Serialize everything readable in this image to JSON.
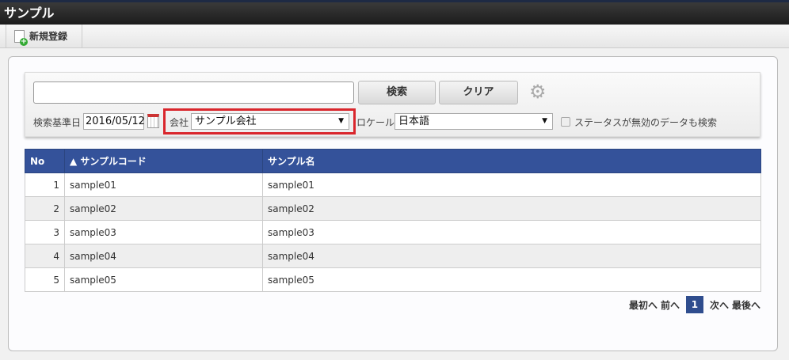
{
  "title": "サンプル",
  "toolbar": {
    "new_label": "新規登録"
  },
  "search": {
    "keyword": "",
    "search_label": "検索",
    "clear_label": "クリア",
    "date_label": "検索基準日",
    "date_value": "2016/05/12",
    "company_label": "会社",
    "company_value": "サンプル会社",
    "locale_label": "ロケール",
    "locale_value": "日本語",
    "include_inactive_label": "ステータスが無効のデータも検索"
  },
  "table": {
    "headers": [
      "No",
      "▲ サンプルコード",
      "サンプル名"
    ],
    "rows": [
      [
        "1",
        "sample01",
        "sample01"
      ],
      [
        "2",
        "sample02",
        "sample02"
      ],
      [
        "3",
        "sample03",
        "sample03"
      ],
      [
        "4",
        "sample04",
        "sample04"
      ],
      [
        "5",
        "sample05",
        "sample05"
      ]
    ]
  },
  "pager": {
    "first": "最初へ",
    "prev": "前へ",
    "current": "1",
    "next": "次へ",
    "last": "最後へ"
  }
}
